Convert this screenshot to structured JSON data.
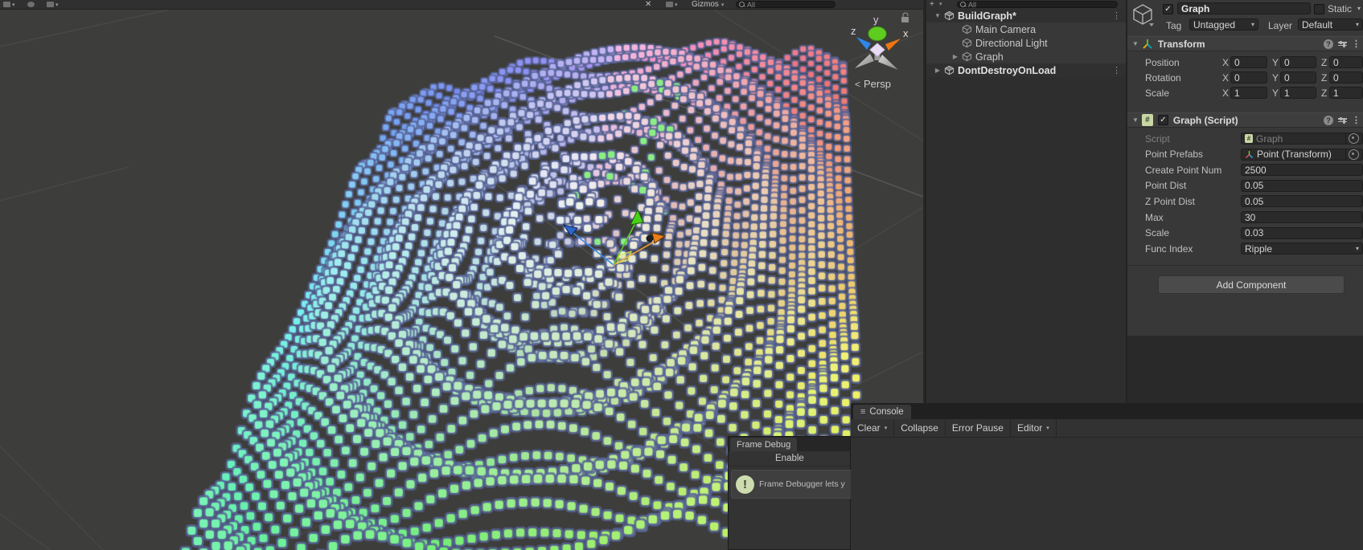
{
  "scene": {
    "toolbar": {
      "gizmos_label": "Gizmos",
      "search_value": "All"
    },
    "persp_label": "Persp",
    "persp_chevron": "<",
    "axes": {
      "x": "x",
      "y": "y",
      "z": "z"
    }
  },
  "hierarchy": {
    "create_button_label": "+",
    "search_value": "All",
    "items": [
      {
        "label": "BuildGraph*",
        "kind": "scene",
        "depth": 0,
        "arrow": "expanded",
        "menu": true
      },
      {
        "label": "Main Camera",
        "kind": "gameobject",
        "depth": 1,
        "arrow": "none",
        "menu": false
      },
      {
        "label": "Directional Light",
        "kind": "gameobject",
        "depth": 1,
        "arrow": "none",
        "menu": false
      },
      {
        "label": "Graph",
        "kind": "gameobject",
        "depth": 1,
        "arrow": "collapsed",
        "menu": false
      },
      {
        "label": "DontDestroyOnLoad",
        "kind": "scene",
        "depth": 0,
        "arrow": "collapsed",
        "menu": true
      }
    ]
  },
  "inspector": {
    "name_value": "Graph",
    "name_enabled": true,
    "static_label": "Static",
    "tag_label": "Tag",
    "tag_value": "Untagged",
    "layer_label": "Layer",
    "layer_value": "Default",
    "transform": {
      "title": "Transform",
      "axis_labels": {
        "x": "X",
        "y": "Y",
        "z": "Z"
      },
      "rows": [
        {
          "label": "Position",
          "x": "0",
          "y": "0",
          "z": "0"
        },
        {
          "label": "Rotation",
          "x": "0",
          "y": "0",
          "z": "0"
        },
        {
          "label": "Scale",
          "x": "1",
          "y": "1",
          "z": "1"
        }
      ]
    },
    "graph_script": {
      "title": "Graph (Script)",
      "fields": [
        {
          "label": "Script",
          "value": "Graph",
          "type": "object",
          "icon": "script",
          "disabled": true
        },
        {
          "label": "Point Prefabs",
          "value": "Point (Transform)",
          "type": "object",
          "icon": "axis",
          "disabled": false
        },
        {
          "label": "Create Point Num",
          "value": "2500",
          "type": "text",
          "disabled": false
        },
        {
          "label": "Point Dist",
          "value": "0.05",
          "type": "text",
          "disabled": false
        },
        {
          "label": "Z Point Dist",
          "value": "0.05",
          "type": "text",
          "disabled": false
        },
        {
          "label": "Max",
          "value": "30",
          "type": "text",
          "disabled": false
        },
        {
          "label": "Scale",
          "value": "0.03",
          "type": "text",
          "disabled": false
        },
        {
          "label": "Func Index",
          "value": "Ripple",
          "type": "dropdown",
          "disabled": false
        }
      ]
    },
    "add_component_label": "Add Component"
  },
  "console": {
    "tab_label": "Console",
    "buttons": [
      {
        "label": "Clear",
        "dropdown": true
      },
      {
        "label": "Collapse",
        "dropdown": false
      },
      {
        "label": "Error Pause",
        "dropdown": false
      },
      {
        "label": "Editor",
        "dropdown": true
      }
    ]
  },
  "frame_debug": {
    "tab_label": "Frame Debug",
    "enable_label": "Enable",
    "info_text": "Frame Debugger lets y"
  }
}
